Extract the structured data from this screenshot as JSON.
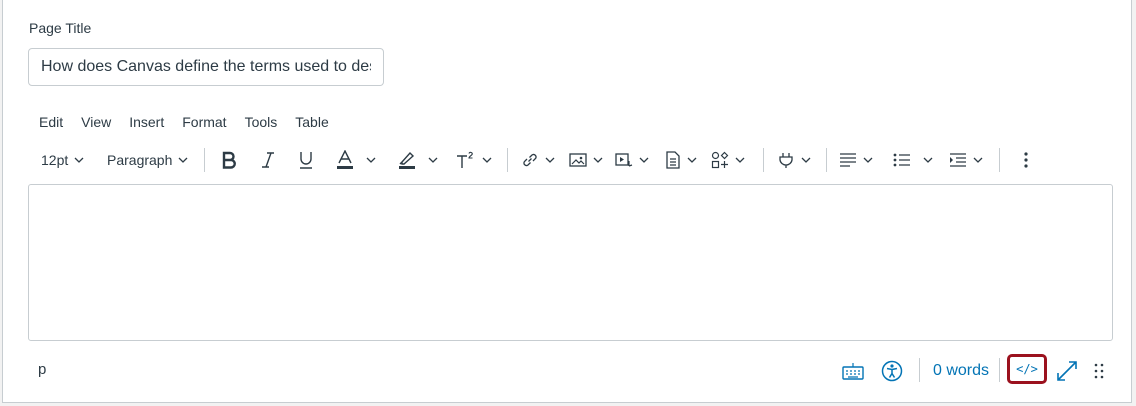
{
  "form": {
    "title_label": "Page Title",
    "title_value": "How does Canvas define the terms used to des"
  },
  "menubar": {
    "items": [
      {
        "label": "Edit"
      },
      {
        "label": "View"
      },
      {
        "label": "Insert"
      },
      {
        "label": "Format"
      },
      {
        "label": "Tools"
      },
      {
        "label": "Table"
      }
    ]
  },
  "toolbar": {
    "font_size": "12pt",
    "block_format": "Paragraph",
    "icons": [
      "bold-icon",
      "italic-icon",
      "underline-icon",
      "text-color-icon",
      "highlight-icon",
      "superscript-icon",
      "link-icon",
      "image-icon",
      "media-icon",
      "document-icon",
      "apps-icon",
      "plug-icon",
      "align-icon",
      "list-icon",
      "indent-icon",
      "more-icon"
    ]
  },
  "statusbar": {
    "path": "p",
    "word_count": "0 words",
    "html_editor_label": "</>"
  },
  "colors": {
    "accent": "#0374b5",
    "highlight_border": "#9b111e",
    "text": "#2d3b45",
    "border": "#c7cdd1"
  }
}
